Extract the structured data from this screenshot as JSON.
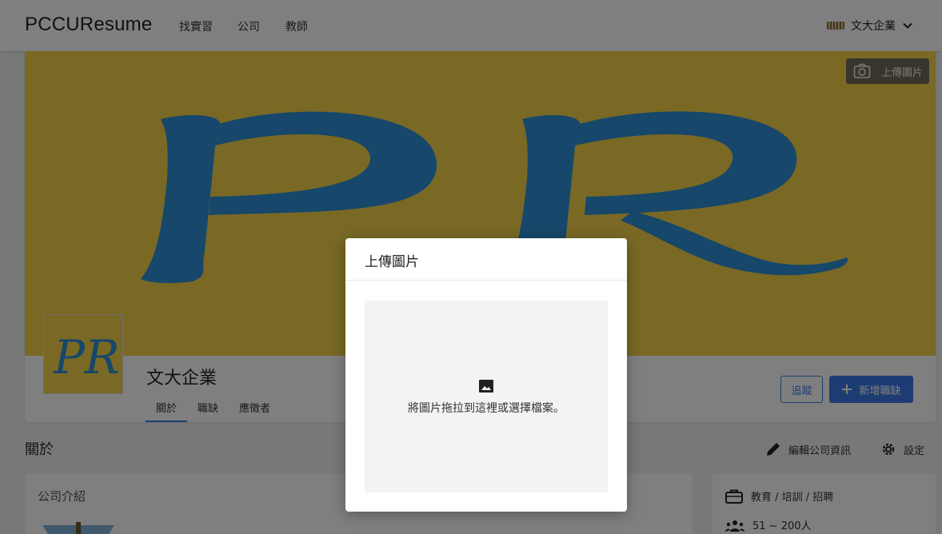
{
  "navbar": {
    "brand": "PCCUResume",
    "links": [
      "找實習",
      "公司",
      "教師"
    ],
    "user_name": "文大企業"
  },
  "cover": {
    "upload_label": "上傳圖片",
    "logo_text": "PR",
    "background_color": "#f2d34a",
    "letter_color": "#2f8fd4"
  },
  "profile": {
    "company_name": "文大企業",
    "tabs": [
      "關於",
      "職缺",
      "應徵者"
    ],
    "active_tab": "關於",
    "follow_label": "追蹤",
    "add_job_label": "新增職缺"
  },
  "about": {
    "section_title": "關於",
    "edit_label": "編輯公司資訊",
    "settings_label": "設定",
    "intro_title": "公司介紹",
    "industry": "教育 / 培訓 / 招聘",
    "size": "51 ~ 200人"
  },
  "modal": {
    "title": "上傳圖片",
    "drop_text": "將圖片拖拉到這裡或選擇檔案。"
  },
  "colors": {
    "accent": "#3b78e7"
  }
}
